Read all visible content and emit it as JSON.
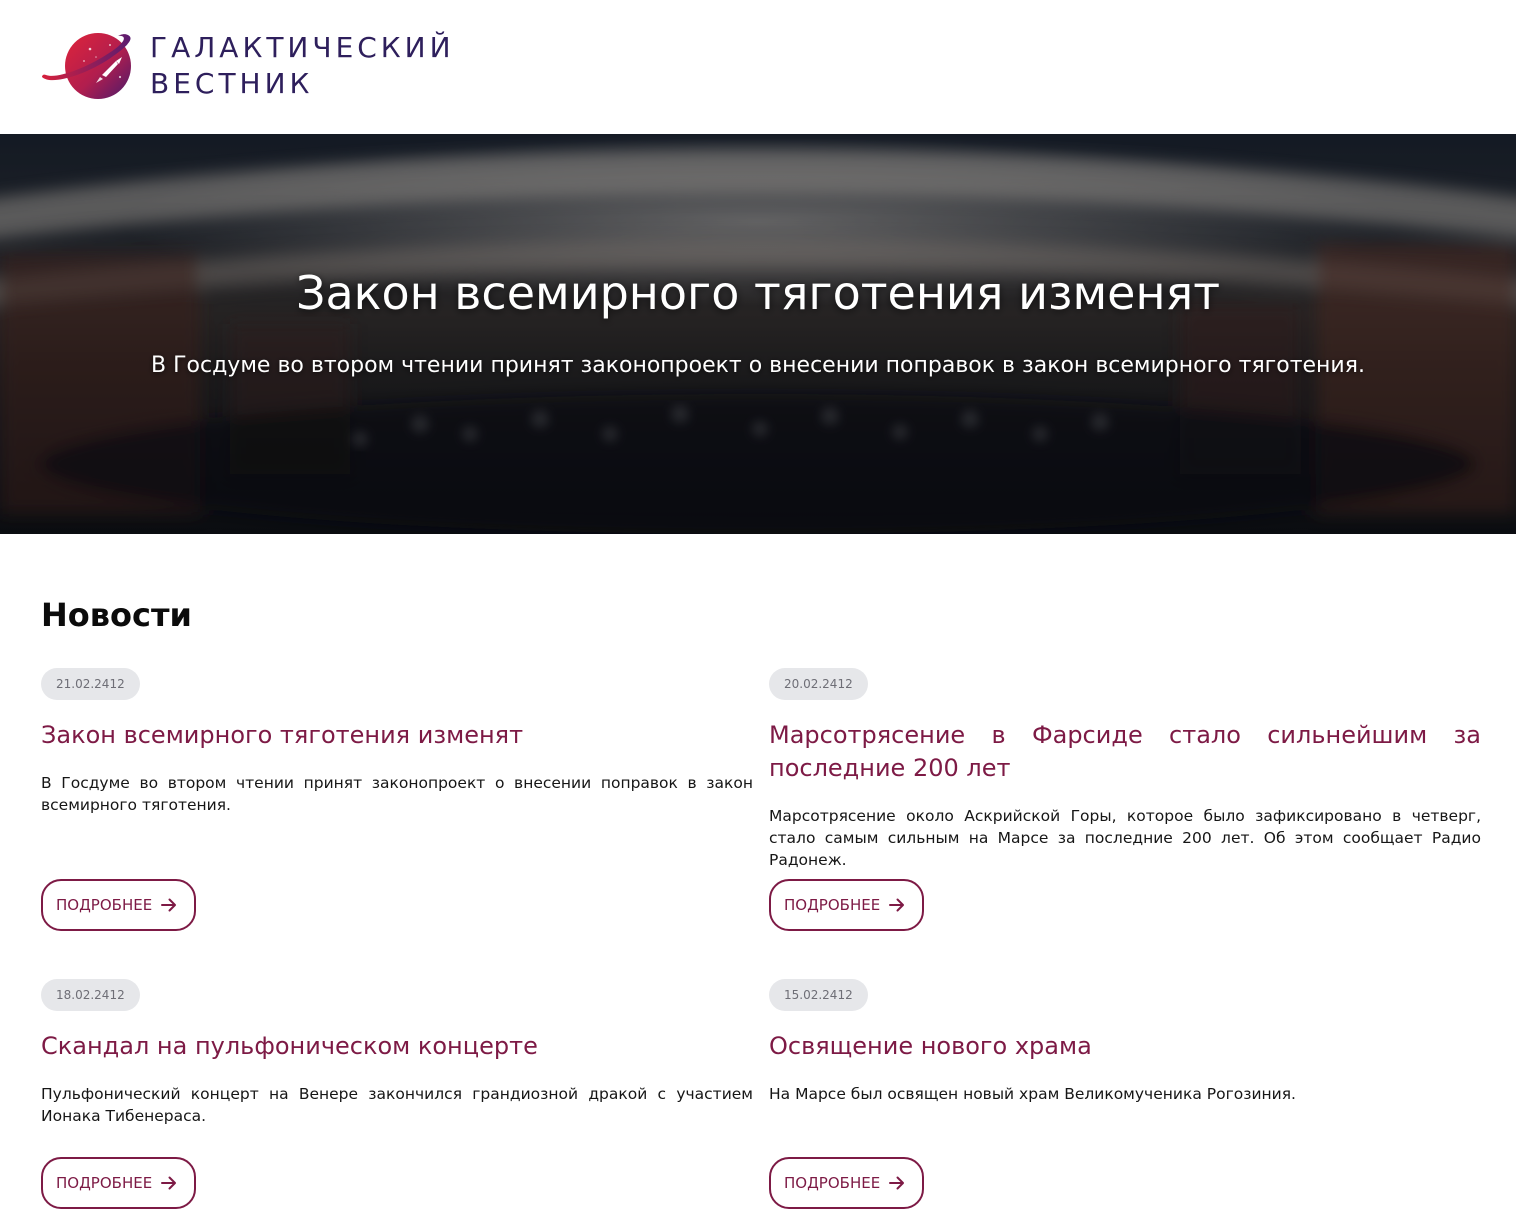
{
  "header": {
    "logo_line1": "ГАЛАКТИЧЕСКИЙ",
    "logo_line2": "ВЕСТНИК",
    "logo_icon": "planet-rocket-icon"
  },
  "hero": {
    "title": "Закон всемирного тяготения изменят",
    "subtitle": "В Госдуме во втором чтении принят законопроект о внесении поправок в закон всемирного тяготения."
  },
  "news": {
    "section_title": "Новости",
    "more_label": "ПОДРОБНЕЕ",
    "more_icon": "arrow-right-icon",
    "items": [
      {
        "date": "21.02.2412",
        "title": "Закон всемирного тяготения изменят",
        "text": "В Госдуме во втором чтении принят законопроект о внесении поправок в закон всемирного тяготения."
      },
      {
        "date": "20.02.2412",
        "title": "Марсотрясение в Фарсиде стало сильнейшим за последние 200 лет",
        "text": "Марсотрясение около Аскрийской Горы, которое было зафиксировано в четверг, стало самым сильным на Марсе за последние 200 лет. Об этом сообщает Радио Радонеж."
      },
      {
        "date": "18.02.2412",
        "title": "Скандал на пульфоническом концерте",
        "text": "Пульфонический концерт на Венере закончился грандиозной дракой с участием Ионака Тибенераса."
      },
      {
        "date": "15.02.2412",
        "title": "Освящение нового храма",
        "text": "На Марсе был освящен новый храм Великомученика Рогозиния."
      }
    ]
  },
  "colors": {
    "accent": "#7d1a45",
    "logo_text": "#2e1f5c",
    "date_bg": "#e6e7ea"
  }
}
